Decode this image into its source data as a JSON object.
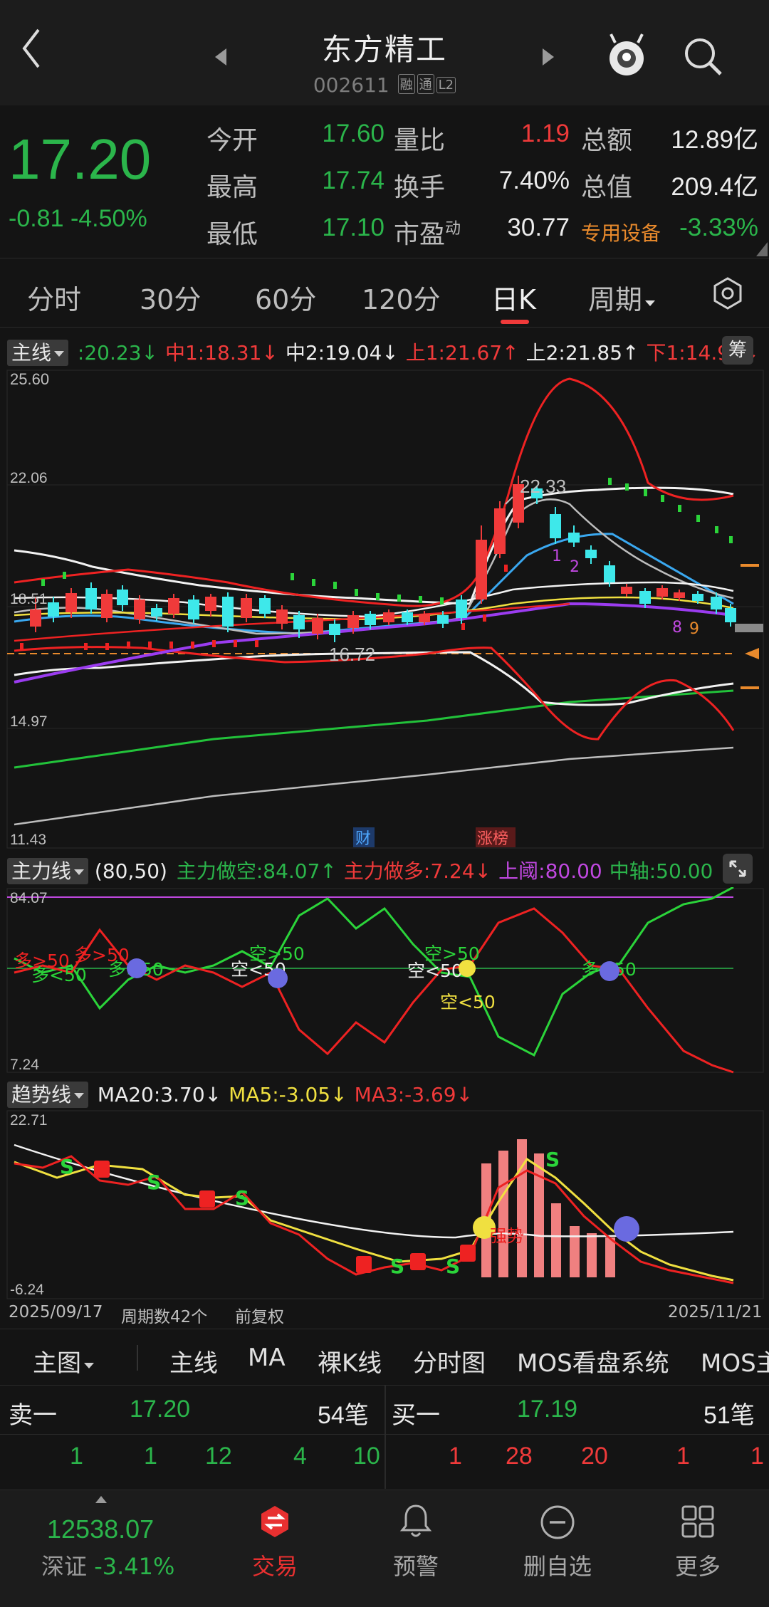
{
  "header": {
    "title": "东方精工",
    "code": "002611",
    "tags": [
      "融",
      "通",
      "L2"
    ]
  },
  "quote": {
    "price": "17.20",
    "change": "-0.81",
    "change_pct": "-4.50%",
    "rows": [
      [
        {
          "label": "今开",
          "value": "17.60",
          "color": "green"
        },
        {
          "label": "量比",
          "value": "1.19",
          "color": "red"
        },
        {
          "label": "总额",
          "value": "12.89亿",
          "color": "white"
        }
      ],
      [
        {
          "label": "最高",
          "value": "17.74",
          "color": "green"
        },
        {
          "label": "换手",
          "value": "7.40%",
          "color": "white"
        },
        {
          "label": "总值",
          "value": "209.4亿",
          "color": "white"
        }
      ],
      [
        {
          "label": "最低",
          "value": "17.10",
          "color": "green"
        },
        {
          "label": "市盈",
          "label_sup": "动",
          "value": "30.77",
          "color": "white"
        },
        {
          "label": "专用设备",
          "value": "-3.33%",
          "color": "green"
        }
      ]
    ]
  },
  "period_tabs": [
    "分时",
    "30分",
    "60分",
    "120分",
    "日K",
    "周期"
  ],
  "active_period": "日K",
  "main_indicator": {
    "button": "主线",
    "values": [
      {
        "text": ":20.23",
        "arrow": "↓",
        "color": "#2bb54b"
      },
      {
        "text": "中1:18.31",
        "arrow": "↓",
        "color": "#f03a3a"
      },
      {
        "text": "中2:19.04",
        "arrow": "↓",
        "color": "#ececec"
      },
      {
        "text": "上1:21.67",
        "arrow": "↑",
        "color": "#f03a3a"
      },
      {
        "text": "上2:21.85",
        "arrow": "↑",
        "color": "#ececec"
      },
      {
        "text": "下1:14.95",
        "arrow": "↓",
        "color": "#f03a3a"
      }
    ],
    "chip_button": "筹",
    "y_ticks": [
      "25.60",
      "22.06",
      "18.51",
      "14.97",
      "11.43"
    ],
    "annotations": {
      "high": "22.33",
      "low": "16.72",
      "news1": "财",
      "news2": "涨榜"
    }
  },
  "force_indicator": {
    "button": "主力线",
    "params": "(80,50)",
    "values": [
      {
        "text": "主力做空:84.07",
        "arrow": "↑",
        "color": "#2bb54b"
      },
      {
        "text": "主力做多:7.24",
        "arrow": "↓",
        "color": "#f03a3a"
      },
      {
        "text": "上阈:80.00",
        "arrow": "",
        "color": "#c048e0"
      },
      {
        "text": "中轴:50.00",
        "arrow": "",
        "color": "#2bb54b"
      }
    ],
    "y_top": "84.07",
    "y_bottom": "7.24",
    "labels": [
      "多>50",
      "多>50",
      "多<50",
      "多>50",
      "空>50",
      "空<50",
      "空>50",
      "空<50",
      "空<50",
      "多>50"
    ]
  },
  "trend_indicator": {
    "button": "趋势线",
    "values": [
      {
        "text": "MA20:3.70",
        "arrow": "↓",
        "color": "#ececec"
      },
      {
        "text": "MA5:-3.05",
        "arrow": "↓",
        "color": "#f0e040"
      },
      {
        "text": "MA3:-3.69",
        "arrow": "↓",
        "color": "#f03a3a"
      }
    ],
    "y_top": "22.71",
    "y_bottom": "-6.24",
    "label_trend": "强势"
  },
  "date_bar": {
    "start": "2025/09/17",
    "count": "周期数42个",
    "adjust": "前复权",
    "end": "2025/11/21"
  },
  "chart_tabs": {
    "main": "主图",
    "items": [
      "主线",
      "MA",
      "裸K线",
      "分时图",
      "MOS看盘系统",
      "MOS主"
    ],
    "active": "主线"
  },
  "orderbook": {
    "sell": {
      "label": "卖一",
      "price": "17.20",
      "count": "54笔",
      "queue": [
        "1",
        "1",
        "12",
        "4",
        "10"
      ]
    },
    "buy": {
      "label": "买一",
      "price": "17.19",
      "count": "51笔",
      "queue": [
        "1",
        "28",
        "20",
        "1",
        "1"
      ]
    }
  },
  "bottom_nav": {
    "index_value": "12538.07",
    "index_name": "深证",
    "index_change": "-3.41%",
    "items": [
      "交易",
      "预警",
      "删自选",
      "更多"
    ]
  }
}
